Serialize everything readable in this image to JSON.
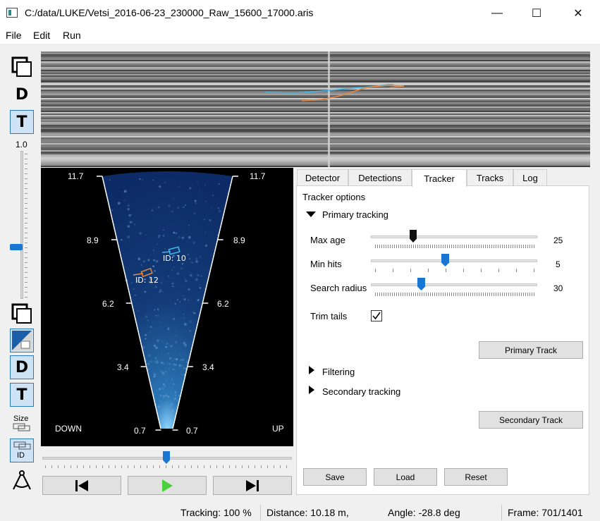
{
  "window": {
    "title": "C:/data/LUKE/Vetsi_2016-06-23_230000_Raw_15600_17000.aris",
    "minimize_glyph": "—",
    "maximize_glyph": "☐",
    "close_glyph": "✕"
  },
  "menu": [
    "File",
    "Edit",
    "Run"
  ],
  "toolbar": {
    "zoom_value": "1.0",
    "detection_letter": "D",
    "tracking_letter": "T",
    "size_label": "Size",
    "id_label": "ID"
  },
  "sonar": {
    "left_ticks": [
      "11.7",
      "8.9",
      "6.2",
      "3.4",
      "0.7"
    ],
    "right_ticks": [
      "11.7",
      "8.9",
      "6.2",
      "3.4",
      "0.7"
    ],
    "down_label": "DOWN",
    "up_label": "UP",
    "fish": [
      {
        "label": "ID: 10",
        "color": "#3fb7e8"
      },
      {
        "label": "ID: 12",
        "color": "#e8873f"
      }
    ]
  },
  "tabs": [
    "Detector",
    "Detections",
    "Tracker",
    "Tracks",
    "Log"
  ],
  "active_tab": "Tracker",
  "tracker": {
    "options_title": "Tracker options",
    "primary_section": "Primary tracking",
    "max_age_label": "Max age",
    "max_age_value": "25",
    "min_hits_label": "Min hits",
    "min_hits_value": "5",
    "search_radius_label": "Search radius",
    "search_radius_value": "30",
    "trim_tails_label": "Trim tails",
    "trim_tails_checked": true,
    "primary_track_button": "Primary Track",
    "filtering_section": "Filtering",
    "secondary_section": "Secondary tracking",
    "secondary_track_button": "Secondary Track",
    "save_button": "Save",
    "load_button": "Load",
    "reset_button": "Reset"
  },
  "status": {
    "tracking": "Tracking: 100 %",
    "distance": "Distance: 10.18 m,",
    "angle": "Angle: -28.8 deg",
    "frame": "Frame: 701/1401"
  },
  "colors": {
    "accent": "#1976d2",
    "track_blue": "#3fb7e8",
    "track_orange": "#e8873f"
  }
}
